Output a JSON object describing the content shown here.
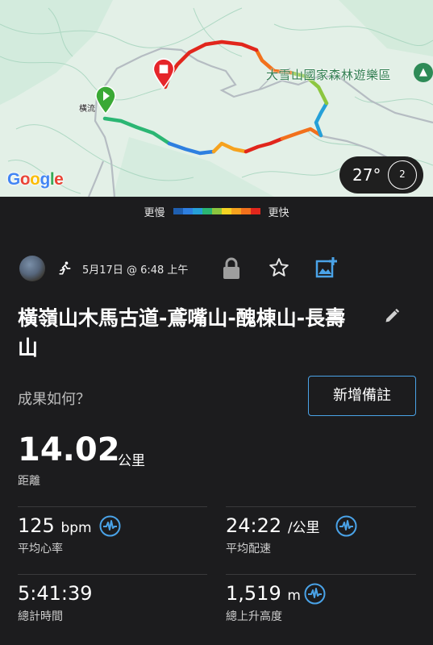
{
  "map": {
    "park_label": "大雪山國家森林遊樂區",
    "village_label": "橫流",
    "google_logo": "Google",
    "temperature": "27°",
    "weather_badge": "2",
    "icons": [
      "start-flag-icon",
      "finish-flag-icon",
      "park-tree-icon"
    ]
  },
  "legend": {
    "slower": "更慢",
    "faster": "更快",
    "colors": [
      "#1f5fb0",
      "#2e7fe0",
      "#26a0d8",
      "#2bb673",
      "#8cc63f",
      "#f5d323",
      "#f6a21e",
      "#f2711c",
      "#e1261c"
    ]
  },
  "activity": {
    "date": "5月17日 @ 6:48 上午",
    "title": "橫嶺山木馬古道-鳶嘴山-醜棟山-長壽山",
    "prompt": "成果如何？",
    "add_note": "新增備註"
  },
  "stats": {
    "distance": {
      "value": "14.02",
      "unit": "公里",
      "label": "距離"
    },
    "heart_rate": {
      "value": "125",
      "unit": "bpm",
      "label": "平均心率"
    },
    "pace": {
      "value": "24:22",
      "unit": "/公里",
      "label": "平均配速"
    },
    "time": {
      "value": "5:41:39",
      "label": "總計時間"
    },
    "elevation": {
      "value": "1,519",
      "unit": "m",
      "label": "總上升高度"
    }
  },
  "colors": {
    "accent": "#4aa3e8",
    "background": "#1c1c1e"
  }
}
